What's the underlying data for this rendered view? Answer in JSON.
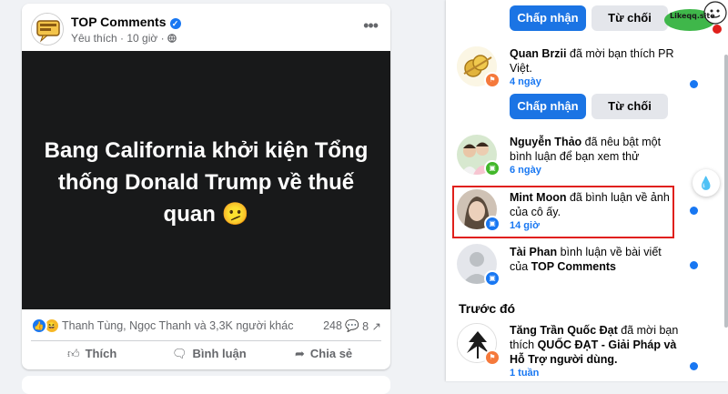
{
  "post": {
    "page_name": "TOP Comments",
    "meta": "Yêu thích · 10 giờ ·",
    "headline_line1": "Bang California khởi kiện Tổng",
    "headline_line2": "thống Donald Trump về thuế",
    "headline_line3": "quan 🫤",
    "reactors": "Thanh Tùng, Ngọc Thanh và 3,3K người khác",
    "comments_count": "248",
    "shares_count": "8",
    "like_label": "Thích",
    "comment_label": "Bình luận",
    "share_label": "Chia sẻ"
  },
  "notifications": {
    "top_actions": {
      "accept": "Chấp nhận",
      "decline": "Từ chối"
    },
    "items": [
      {
        "name": "Quan Brzii",
        "text": " đã mời bạn thích PR Việt.",
        "time": "4 ngày",
        "accept": "Chấp nhận",
        "decline": "Từ chối",
        "badge_color": "#f5793b"
      },
      {
        "name": "Nguyễn Thảo",
        "text": " đã nêu bật một bình luận để bạn xem thử",
        "time": "6 ngày",
        "badge_color": "#42b72a"
      },
      {
        "name": "Mint Moon",
        "text": " đã bình luận về ảnh của cô ấy.",
        "time": "14 giờ",
        "badge_color": "#1877f2"
      },
      {
        "name": "Tài Phan",
        "text": " bình luận về bài viết của ",
        "target": "TOP Comments",
        "time": "",
        "badge_color": "#1877f2"
      },
      {
        "name": "Tăng Trần Quốc Đạt",
        "text": " đã mời bạn thích ",
        "target": "QUỐC ĐẠT - Giải Pháp và Hỗ Trợ người dùng.",
        "time": "1 tuần",
        "badge_color": "#f5793b"
      }
    ],
    "section_earlier": "Trước đó"
  },
  "watermark": {
    "text": "Likeqq.site"
  }
}
